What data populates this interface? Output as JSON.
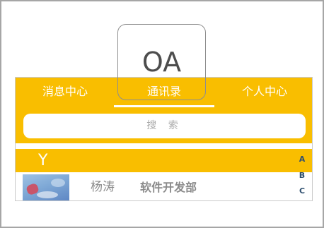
{
  "tabs": [
    {
      "label": "消息中心"
    },
    {
      "label": "通讯录"
    },
    {
      "label": "个人中心"
    }
  ],
  "active_tab": "通讯录",
  "search": {
    "placeholder": "搜 索"
  },
  "section": {
    "letter": "Y"
  },
  "contact": {
    "name": "杨涛",
    "department": "软件开发部"
  },
  "index": [
    "A",
    "B",
    "C"
  ],
  "logo": {
    "text": "OA"
  },
  "colors": {
    "accent": "#f9be00",
    "text_gray": "#8b8b8b",
    "index_text": "#2f4f6f"
  }
}
